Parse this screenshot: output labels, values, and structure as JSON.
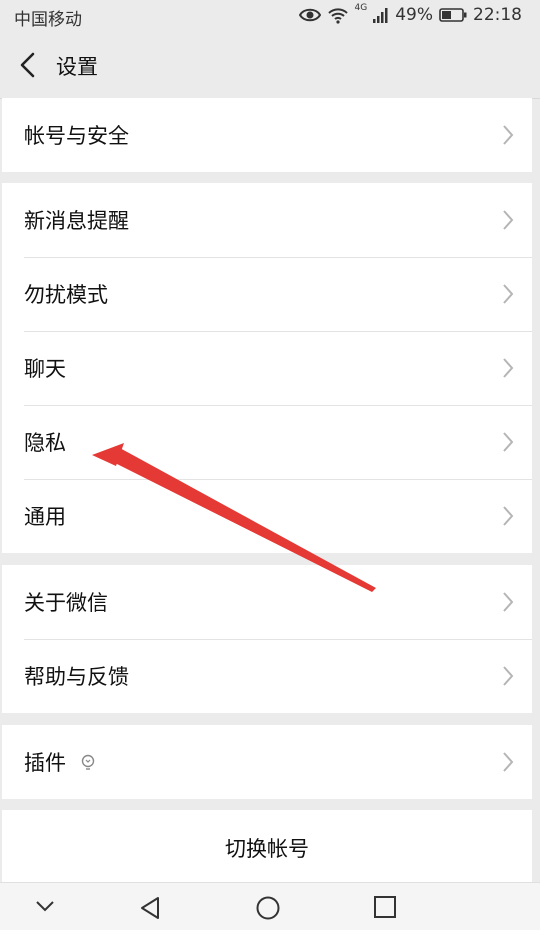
{
  "status_bar": {
    "carrier": "中国移动",
    "network": "4G",
    "battery": "49%",
    "time": "22:18"
  },
  "header": {
    "back_icon": "chevron-left-icon",
    "title": "设置"
  },
  "groups": [
    {
      "items": [
        {
          "label": "帐号与安全"
        }
      ]
    },
    {
      "items": [
        {
          "label": "新消息提醒"
        },
        {
          "label": "勿扰模式"
        },
        {
          "label": "聊天"
        },
        {
          "label": "隐私"
        },
        {
          "label": "通用"
        }
      ]
    },
    {
      "items": [
        {
          "label": "关于微信"
        },
        {
          "label": "帮助与反馈"
        }
      ]
    },
    {
      "items": [
        {
          "label": "插件"
        }
      ]
    }
  ],
  "switch_account": {
    "label": "切换帐号"
  },
  "annotation": {
    "color": "#e53935",
    "points_to": "隐私"
  },
  "colors": {
    "background": "#ebebeb",
    "card": "#ffffff",
    "chevron": "#b5b5b5"
  }
}
